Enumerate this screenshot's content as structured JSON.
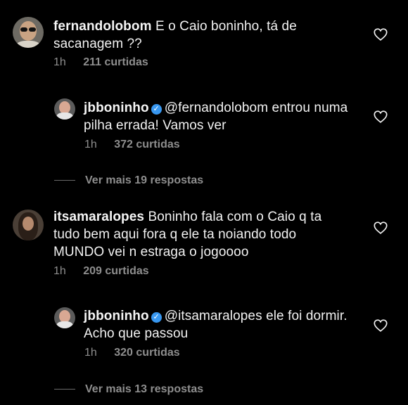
{
  "comments": [
    {
      "username": "fernandolobom",
      "text": "E o Caio boninho, tá de sacanagem ??",
      "time": "1h",
      "likes": "211 curtidas",
      "avatar_icon": "profile-photo-man-sunglasses"
    },
    {
      "username": "jbboninho",
      "verified_icon": "verified-badge-icon",
      "mention": "@fernandolobom",
      "text": "entrou numa pilha errada! Vamos ver",
      "time": "1h",
      "likes": "372 curtidas",
      "avatar_icon": "profile-photo-man"
    },
    {
      "username": "itsamaralopes",
      "text": "Boninho fala com o Caio q ta tudo bem aqui fora q ele ta noiando todo MUNDO vei n estraga o jogoooo",
      "time": "1h",
      "likes": "209 curtidas",
      "avatar_icon": "profile-photo-woman"
    },
    {
      "username": "jbboninho",
      "verified_icon": "verified-badge-icon",
      "mention": "@itsamaralopes",
      "text": "ele foi dormir. Acho que passou",
      "time": "1h",
      "likes": "320 curtidas",
      "avatar_icon": "profile-photo-man"
    }
  ],
  "view_more": [
    "Ver mais 19 respostas",
    "Ver mais 13 respostas"
  ],
  "colors": {
    "background": "#000000",
    "text": "#f2f2f2",
    "meta": "#8e8e8e",
    "verified": "#3897f0"
  }
}
